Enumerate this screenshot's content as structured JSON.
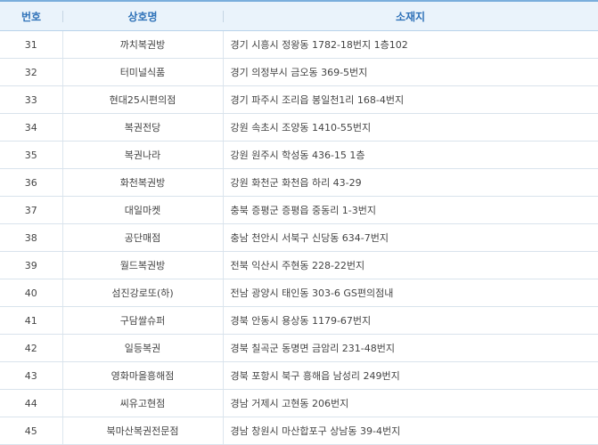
{
  "header": {
    "col_number": "번호",
    "col_name": "상호명",
    "col_address": "소재지"
  },
  "rows": [
    {
      "number": "31",
      "name": "까치복권방",
      "address": "경기 시흥시 정왕동 1782-18번지 1층102"
    },
    {
      "number": "32",
      "name": "터미널식품",
      "address": "경기 의정부시 금오동 369-5번지"
    },
    {
      "number": "33",
      "name": "현대25시편의점",
      "address": "경기 파주시 조리읍 봉일천1리 168-4번지"
    },
    {
      "number": "34",
      "name": "복권전당",
      "address": "강원 속초시 조양동 1410-55번지"
    },
    {
      "number": "35",
      "name": "복권나라",
      "address": "강원 원주시 학성동 436-15 1층"
    },
    {
      "number": "36",
      "name": "화천복권방",
      "address": "강원 화천군 화천읍 하리 43-29"
    },
    {
      "number": "37",
      "name": "대일마켓",
      "address": "충북 증평군 증평읍 중동리 1-3번지"
    },
    {
      "number": "38",
      "name": "공단매점",
      "address": "충남 천안시 서북구 신당동 634-7번지"
    },
    {
      "number": "39",
      "name": "월드복권방",
      "address": "전북 익산시 주현동 228-22번지"
    },
    {
      "number": "40",
      "name": "섬진강로또(하)",
      "address": "전남 광양시 태인동 303-6 GS편의점내"
    },
    {
      "number": "41",
      "name": "구담쌀슈퍼",
      "address": "경북 안동시 용상동 1179-67번지"
    },
    {
      "number": "42",
      "name": "일등복권",
      "address": "경북 칠곡군 동명면 금암리 231-48번지"
    },
    {
      "number": "43",
      "name": "영화마을흥해점",
      "address": "경북 포항시 북구 흥해읍 남성리 249번지"
    },
    {
      "number": "44",
      "name": "씨유고현점",
      "address": "경남 거제시 고현동 206번지"
    },
    {
      "number": "45",
      "name": "북마산복권전문점",
      "address": "경남 창원시 마산합포구 상남동 39-4번지"
    }
  ]
}
